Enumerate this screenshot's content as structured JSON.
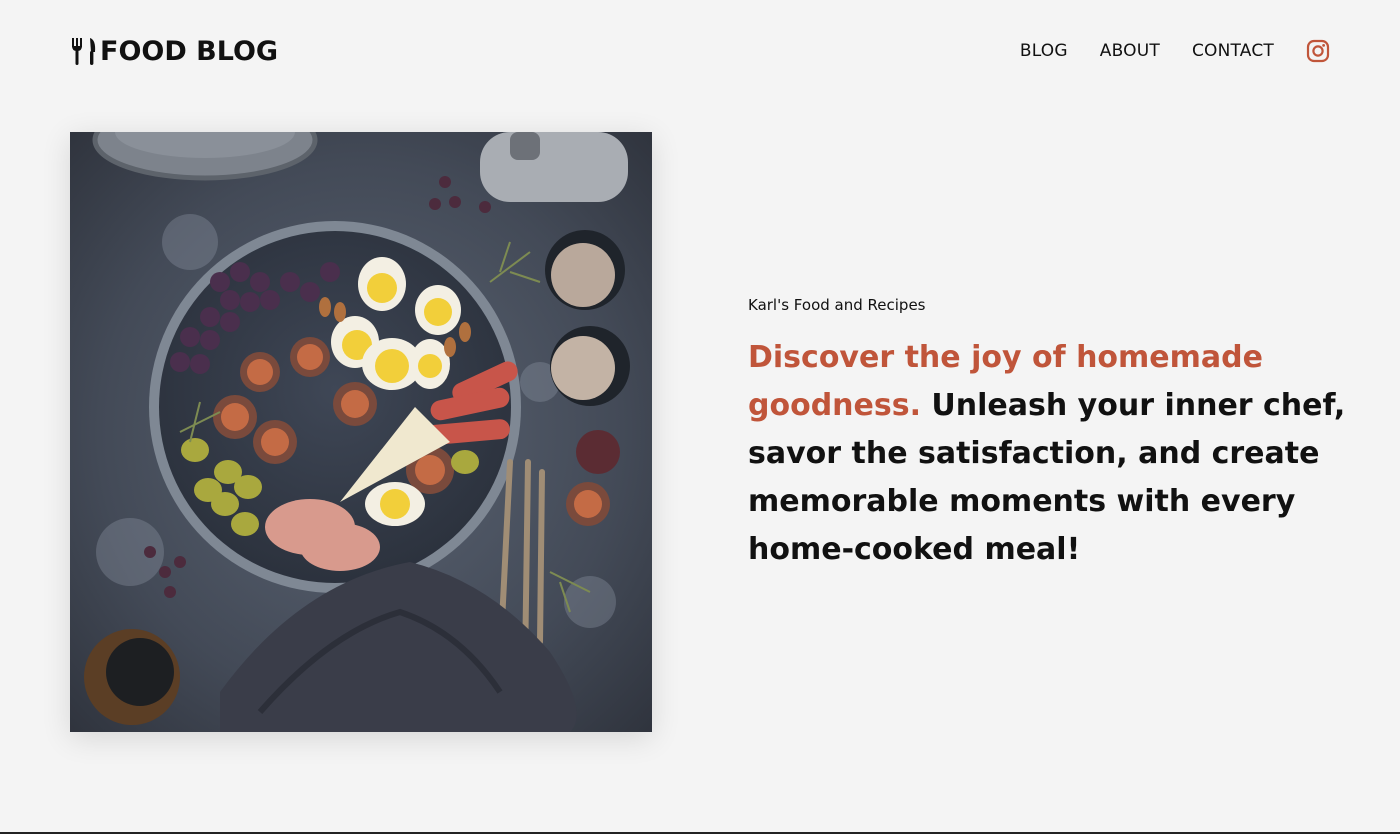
{
  "brand": {
    "logo_text": "FOOD BLOG",
    "logo_icon": "fork-knife-icon",
    "accent_color": "#c0553a"
  },
  "nav": {
    "items": [
      "BLOG",
      "ABOUT",
      "CONTACT"
    ],
    "social_icon": "instagram-icon"
  },
  "hero": {
    "eyebrow": "Karl's Food and Recipes",
    "headline_accent": "Discover the joy of homemade goodness.",
    "headline_rest": " Unleash your inner chef, savor the satisfaction, and create memorable moments with every home-cooked meal!"
  }
}
